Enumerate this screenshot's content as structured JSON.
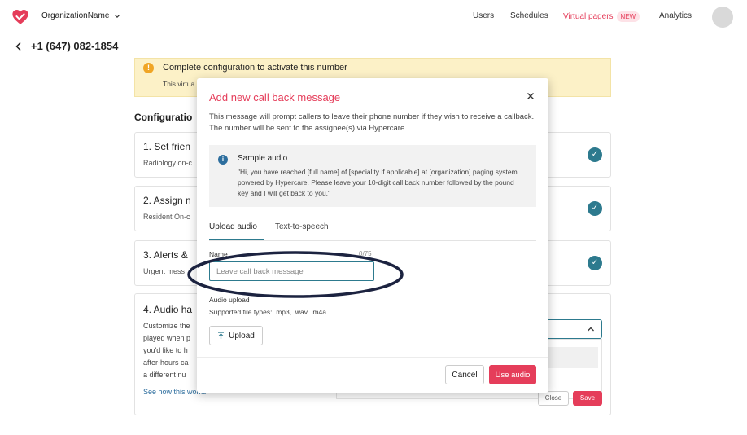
{
  "colors": {
    "brand": "#e53d5a",
    "teal": "#2d7a8e",
    "warning": "#f0a524",
    "annotation": "#1c2340"
  },
  "nav": {
    "org_name": "OrganizationName",
    "links": [
      "Users",
      "Schedules",
      "Virtual pagers",
      "Analytics"
    ],
    "new_badge": "NEW"
  },
  "header": {
    "phone": "+1 (647) 082-1854"
  },
  "banner": {
    "title": "Complete configuration to activate this number",
    "subtitle": "This virtua"
  },
  "config": {
    "title": "Configuratio",
    "cards": [
      {
        "title": "1. Set frien",
        "subtitle": "Radiology on-c"
      },
      {
        "title": "2. Assign n",
        "subtitle": "Resident On-c"
      },
      {
        "title": "3. Alerts &",
        "subtitle": "Urgent mess"
      }
    ],
    "card4": {
      "title": "4. Audio ha",
      "lines": [
        "Customize the",
        "played when p",
        "you'd like to h",
        "after-hours ca",
        "a different nu"
      ],
      "link": "See how this works"
    },
    "bg_close": "Close",
    "bg_save": "Save"
  },
  "modal": {
    "title": "Add new call back message",
    "description": "This message will prompt callers to leave their phone number if they wish to receive a callback. The number will be sent to the assignee(s) via Hypercare.",
    "sample_title": "Sample audio",
    "sample_text": "\"Hi, you have reached [full name] of [speciality if applicable] at [organization] paging system powered by Hypercare. Please leave your 10-digit call back number followed by the pound key and I will get back to you.\"",
    "tabs": [
      "Upload audio",
      "Text-to-speech"
    ],
    "name_label": "Name",
    "char_count": "0/75",
    "name_placeholder": "Leave call back message",
    "audio_label": "Audio upload",
    "audio_types": "Supported file types: .mp3, .wav, .m4a",
    "upload_label": "Upload",
    "cancel_label": "Cancel",
    "use_label": "Use audio"
  }
}
